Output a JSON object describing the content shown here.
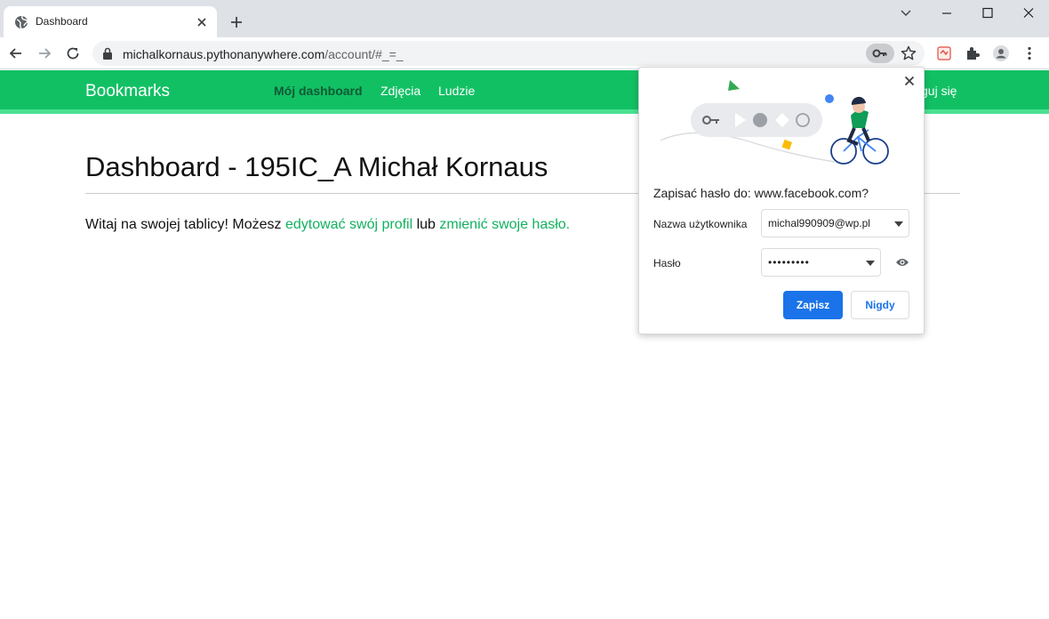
{
  "browser": {
    "tab": {
      "title": "Dashboard"
    },
    "address_bar": {
      "host": "michalkornaus.pythonanywhere.com",
      "path": "/account/#_=_"
    }
  },
  "site": {
    "brand": "Bookmarks",
    "nav": [
      {
        "label": "Mój dashboard",
        "active": true
      },
      {
        "label": "Zdjęcia",
        "active": false
      },
      {
        "label": "Ludzie",
        "active": false
      }
    ],
    "logout_partial": "guj się",
    "colors": {
      "header": "#12c064",
      "link": "#12b160"
    }
  },
  "page": {
    "title": "Dashboard - 195IC_A Michał Kornaus",
    "welcome": {
      "before": "Witaj na swojej tablicy! Możesz ",
      "link1": "edytować swój profil",
      "middle": " lub ",
      "link2": "zmienić swoje hasło."
    }
  },
  "save_password_popup": {
    "title": "Zapisać hasło do: www.facebook.com?",
    "username_label": "Nazwa użytkownika",
    "username_value": "michal990909@wp.pl",
    "password_label": "Hasło",
    "password_value": "•••••••••",
    "save_button": "Zapisz",
    "never_button": "Nigdy",
    "colors": {
      "primary": "#1a73e8"
    }
  }
}
